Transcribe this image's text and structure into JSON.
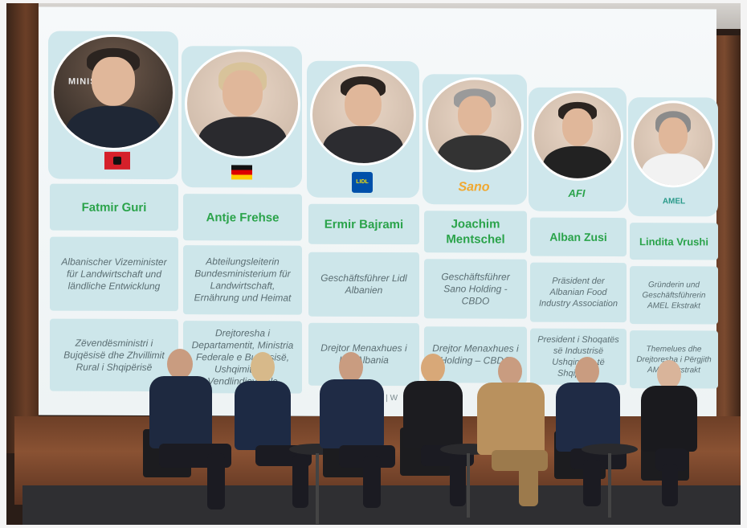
{
  "panelists": [
    {
      "name": "Fatmir Guri",
      "logo": "",
      "title_de": "Albanischer Vizeminister für Landwirtschaft und ländliche Entwicklung",
      "title_sq": "Zëvendësministri i Bujqësisë dhe Zhvillimit Rural i Shqipërisë",
      "flag": "albania-flag-icon"
    },
    {
      "name": "Antje Frehse",
      "logo": "",
      "title_de": "Abteilungsleiterin Bundesministerium für Landwirtschaft, Ernährung und Heimat",
      "title_sq": "Drejtoresha i Departamentit, Ministria Federale e Bujqësisë, Ushqimit dhe Vendlindjeve ale",
      "flag": "germany-flag-icon"
    },
    {
      "name": "Ermir Bajrami",
      "logo": "LIDL",
      "title_de": "Geschäftsführer Lidl Albanien",
      "title_sq": "Drejtor Menaxhues i Lidl Albania",
      "flag": "lidl-logo-icon"
    },
    {
      "name": "Joachim Mentschel",
      "logo": "Sano",
      "title_de": "Geschäftsführer Sano Holding - CBDO",
      "title_sq": "Drejtor Menaxhues i Holding – CBDO",
      "flag": "sano-logo-icon"
    },
    {
      "name": "Alban Zusi",
      "logo": "AFI",
      "title_de": "Präsident der Albanian Food Industry Association",
      "title_sq": "President i Shoqatës së Industrisë Ushqimore të Shqipërisë",
      "flag": "afi-logo-icon"
    },
    {
      "name": "Lindita Vrushi",
      "logo": "AMEL",
      "title_de": "Gründerin und Geschäftsführerin AMEL Ekstrakt",
      "title_sq": "Themelues dhe Drejtoresha i Përgjith AMEL Ekstrakt",
      "flag": "amel-logo-icon"
    }
  ],
  "portrait_sign": "MINIST",
  "footer_fragment": "LEH | W",
  "colors": {
    "name_green": "#2aa34a",
    "card_bg": "#cde6ea",
    "screen_bg": "#f2f6f7",
    "wood": "#7b4a2f"
  }
}
